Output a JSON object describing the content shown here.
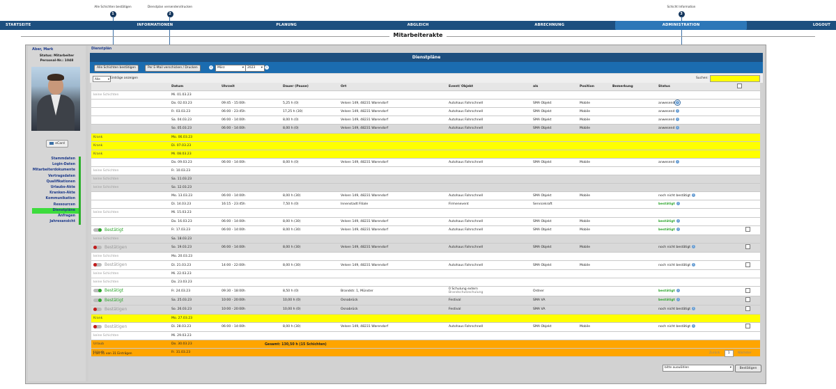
{
  "annotations": [
    {
      "label": "Alle Schichten bestätigen",
      "num": "1"
    },
    {
      "label": "Dienstplan versenden/drucken",
      "num": "2"
    },
    {
      "label": "Schicht Information",
      "num": "3"
    }
  ],
  "nav": [
    "STARTSEITE",
    "INFORMATIONEN",
    "PLANUNG",
    "ABGLEICH",
    "ABRECHNUNG",
    "ADMINISTRATION",
    "LOGOUT"
  ],
  "page_title": "Mitarbeiterakte",
  "employee": {
    "name": "Aber, Mark",
    "status": "Status: Mitarbeiter",
    "personal_nr": "Personal-Nr.: 1048",
    "ecard": "eCard"
  },
  "left_menu": [
    "Stammdaten",
    "Login-Daten",
    "Mitarbeiterdokumente",
    "Vertragsdaten",
    "Qualifikationen",
    "Urlaubs-Akte",
    "Kranken-Akte",
    "Kommunikation",
    "Ressourcen",
    "Dienstpläne",
    "Anfragen",
    "Jahresansicht"
  ],
  "breadcrumb": "Dienstplän",
  "panel_title": "Dienstpläne",
  "toolbar": {
    "confirm_all": "Alle Schichten bestätigen",
    "email_print": "Per E-Mail verschicken / Drucken",
    "month": "März",
    "year": "2023"
  },
  "list": {
    "length_select": "Alle",
    "length_text": "Einträge anzeigen",
    "search_label": "Suchen:"
  },
  "table": {
    "headers": [
      "",
      "Datum",
      "Uhrzeit",
      "Dauer (Pause)",
      "Ort",
      "Event/ Objekt",
      "als",
      "Position",
      "Bemerkung",
      "Status",
      ""
    ],
    "rows": [
      {
        "c": "n",
        "a": "keine Schichten",
        "d": "Mi. 01.03.23",
        "t": "",
        "dur": "",
        "o": "",
        "e": "",
        "e2": "",
        "al": "",
        "p": "",
        "b": "",
        "s": "",
        "si": false,
        "cb": false
      },
      {
        "c": "w",
        "a": "",
        "d": "Do. 02.03.23",
        "t": "09:45 - 15:00h",
        "dur": "5,25 h (0)",
        "o": "Velsen 149, 48231 Warendorf",
        "e": "Autohaus Fahrschnell",
        "e2": "",
        "al": "SMA Objekt",
        "p": "Mobile",
        "b": "",
        "s": "anwesend",
        "si": true,
        "ring": true,
        "cb": false
      },
      {
        "c": "w",
        "a": "",
        "d": "Fr. 03.03.23",
        "t": "06:00 - 23:45h",
        "dur": "17,25 h (30)",
        "o": "Velsen 149, 48231 Warendorf",
        "e": "Autohaus Fahrschnell",
        "e2": "",
        "al": "SMA Objekt",
        "p": "Mobile",
        "b": "",
        "s": "anwesend",
        "si": true,
        "cb": false
      },
      {
        "c": "w",
        "a": "",
        "d": "Sa. 04.03.23",
        "t": "06:00 - 14:00h",
        "dur": "8,00 h (0)",
        "o": "Velsen 149, 48231 Warendorf",
        "e": "Autohaus Fahrschnell",
        "e2": "",
        "al": "SMA Objekt",
        "p": "Mobile",
        "b": "",
        "s": "anwesend",
        "si": true,
        "cb": false
      },
      {
        "c": "g",
        "a": "",
        "d": "So. 05.03.23",
        "t": "06:00 - 14:00h",
        "dur": "8,00 h (0)",
        "o": "Velsen 149, 48231 Warendorf",
        "e": "Autohaus Fahrschnell",
        "e2": "",
        "al": "SMA Objekt",
        "p": "Mobile",
        "b": "",
        "s": "anwesend",
        "si": true,
        "cb": false
      },
      {
        "c": "k",
        "a": "Krank",
        "d": "Mo. 06.03.23",
        "t": "",
        "dur": "",
        "o": "",
        "e": "",
        "e2": "",
        "al": "",
        "p": "",
        "b": "",
        "s": "",
        "si": false,
        "cb": false
      },
      {
        "c": "k",
        "a": "Krank",
        "d": "Di. 07.03.23",
        "t": "",
        "dur": "",
        "o": "",
        "e": "",
        "e2": "",
        "al": "",
        "p": "",
        "b": "",
        "s": "",
        "si": false,
        "cb": false
      },
      {
        "c": "k",
        "a": "Krank",
        "d": "Mi. 08.03.23",
        "t": "",
        "dur": "",
        "o": "",
        "e": "",
        "e2": "",
        "al": "",
        "p": "",
        "b": "",
        "s": "",
        "si": false,
        "cb": false
      },
      {
        "c": "w",
        "a": "",
        "d": "Do. 09.03.23",
        "t": "06:00 - 14:00h",
        "dur": "8,00 h (0)",
        "o": "Velsen 149, 48231 Warendorf",
        "e": "Autohaus Fahrschnell",
        "e2": "",
        "al": "SMA Objekt",
        "p": "Mobile",
        "b": "",
        "s": "anwesend",
        "si": true,
        "cb": false
      },
      {
        "c": "n",
        "a": "keine Schichten",
        "d": "Fr. 10.03.23",
        "t": "",
        "dur": "",
        "o": "",
        "e": "",
        "e2": "",
        "al": "",
        "p": "",
        "b": "",
        "s": "",
        "si": false,
        "cb": false
      },
      {
        "c": "gn",
        "a": "keine Schichten",
        "d": "Sa. 11.03.23",
        "t": "",
        "dur": "",
        "o": "",
        "e": "",
        "e2": "",
        "al": "",
        "p": "",
        "b": "",
        "s": "",
        "si": false,
        "cb": false
      },
      {
        "c": "gn",
        "a": "keine Schichten",
        "d": "So. 12.03.23",
        "t": "",
        "dur": "",
        "o": "",
        "e": "",
        "e2": "",
        "al": "",
        "p": "",
        "b": "",
        "s": "",
        "si": false,
        "cb": false
      },
      {
        "c": "w",
        "a": "",
        "d": "Mo. 13.03.23",
        "t": "06:00 - 14:00h",
        "dur": "8,00 h (30)",
        "o": "Velsen 149, 48231 Warendorf",
        "e": "Autohaus Fahrschnell",
        "e2": "",
        "al": "SMA Objekt",
        "p": "Mobile",
        "b": "",
        "s": "noch nicht bestätigt",
        "si": true,
        "cb": false
      },
      {
        "c": "w",
        "a": "",
        "d": "Di. 14.03.23",
        "t": "16:15 - 23:45h",
        "dur": "7,50 h (0)",
        "o": "Innenstadt Filiale",
        "e": "Firmenevent",
        "e2": "",
        "al": "Servicekraft",
        "p": "",
        "b": "",
        "s": "bestätigt",
        "sg": true,
        "si": true,
        "cb": false
      },
      {
        "c": "n",
        "a": "keine Schichten",
        "d": "Mi. 15.03.23",
        "t": "",
        "dur": "",
        "o": "",
        "e": "",
        "e2": "",
        "al": "",
        "p": "",
        "b": "",
        "s": "",
        "si": false,
        "cb": false
      },
      {
        "c": "w",
        "a": "",
        "d": "Do. 16.03.23",
        "t": "06:00 - 14:00h",
        "dur": "8,00 h (30)",
        "o": "Velsen 149, 48231 Warendorf",
        "e": "Autohaus Fahrschnell",
        "e2": "",
        "al": "SMA Objekt",
        "p": "Mobile",
        "b": "",
        "s": "bestätigt",
        "sg": true,
        "si": true,
        "cb": false
      },
      {
        "c": "w",
        "a": "tog_on",
        "d": "Fr. 17.03.23",
        "t": "06:00 - 14:00h",
        "dur": "8,00 h (30)",
        "o": "Velsen 149, 48231 Warendorf",
        "e": "Autohaus Fahrschnell",
        "e2": "",
        "al": "SMA Objekt",
        "p": "Mobile",
        "b": "",
        "s": "bestätigt",
        "sg": true,
        "si": true,
        "cb": true
      },
      {
        "c": "gn",
        "a": "keine Schichten",
        "d": "Sa. 18.03.23",
        "t": "",
        "dur": "",
        "o": "",
        "e": "",
        "e2": "",
        "al": "",
        "p": "",
        "b": "",
        "s": "",
        "si": false,
        "cb": false
      },
      {
        "c": "g",
        "a": "tog_off",
        "d": "So. 19.03.23",
        "t": "06:00 - 14:00h",
        "dur": "8,00 h (30)",
        "o": "Velsen 149, 48231 Warendorf",
        "e": "Autohaus Fahrschnell",
        "e2": "",
        "al": "SMA Objekt",
        "p": "Mobile",
        "b": "",
        "s": "noch nicht bestätigt",
        "si": true,
        "cb": true
      },
      {
        "c": "n",
        "a": "keine Schichten",
        "d": "Mo. 20.03.23",
        "t": "",
        "dur": "",
        "o": "",
        "e": "",
        "e2": "",
        "al": "",
        "p": "",
        "b": "",
        "s": "",
        "si": false,
        "cb": false
      },
      {
        "c": "w",
        "a": "tog_off",
        "d": "Di. 21.03.23",
        "t": "14:00 - 22:00h",
        "dur": "8,00 h (30)",
        "o": "Velsen 149, 48231 Warendorf",
        "e": "Autohaus Fahrschnell",
        "e2": "",
        "al": "SMA Objekt",
        "p": "Mobile",
        "b": "",
        "s": "noch nicht bestätigt",
        "si": true,
        "cb": true
      },
      {
        "c": "n",
        "a": "keine Schichten",
        "d": "Mi. 22.03.23",
        "t": "",
        "dur": "",
        "o": "",
        "e": "",
        "e2": "",
        "al": "",
        "p": "",
        "b": "",
        "s": "",
        "si": false,
        "cb": false
      },
      {
        "c": "n",
        "a": "keine Schichten",
        "d": "Do. 23.03.23",
        "t": "",
        "dur": "",
        "o": "",
        "e": "",
        "e2": "",
        "al": "",
        "p": "",
        "b": "",
        "s": "",
        "si": false,
        "cb": false
      },
      {
        "c": "w",
        "a": "tog_on",
        "d": "Fr. 24.03.23",
        "t": "09:30 - 18:00h",
        "dur": "8,50 h (0)",
        "o": "Brandstr. 1, Münster",
        "e": "0 Schulung extern",
        "e2": "Brandschutzschulung",
        "al": "Ordner",
        "p": "",
        "b": "",
        "s": "bestätigt",
        "sg": true,
        "si": true,
        "cb": true
      },
      {
        "c": "g",
        "a": "tog_on",
        "d": "Sa. 25.03.23",
        "t": "10:00 - 20:00h",
        "dur": "10,00 h (0)",
        "o": "Osnabrück",
        "e": "Festival",
        "e2": "",
        "al": "SMA VA",
        "p": "",
        "b": "",
        "s": "bestätigt",
        "sg": true,
        "si": true,
        "cb": true
      },
      {
        "c": "g",
        "a": "tog_off",
        "d": "So. 26.03.23",
        "t": "10:00 - 20:00h",
        "dur": "10,00 h (0)",
        "o": "Osnabrück",
        "e": "Festival",
        "e2": "",
        "al": "SMA VA",
        "p": "",
        "b": "",
        "s": "noch nicht bestätigt",
        "si": true,
        "cb": true
      },
      {
        "c": "k",
        "a": "Krank",
        "d": "Mo. 27.03.23",
        "t": "",
        "dur": "",
        "o": "",
        "e": "",
        "e2": "",
        "al": "",
        "p": "",
        "b": "",
        "s": "",
        "si": false,
        "cb": false
      },
      {
        "c": "w",
        "a": "tog_off",
        "d": "Di. 28.03.23",
        "t": "06:00 - 14:00h",
        "dur": "8,00 h (30)",
        "o": "Velsen 149, 48231 Warendorf",
        "e": "Autohaus Fahrschnell",
        "e2": "",
        "al": "SMA Objekt",
        "p": "Mobile",
        "b": "",
        "s": "noch nicht bestätigt",
        "si": true,
        "cb": true
      },
      {
        "c": "n",
        "a": "keine Schichten",
        "d": "Mi. 29.03.23",
        "t": "",
        "dur": "",
        "o": "",
        "e": "",
        "e2": "",
        "al": "",
        "p": "",
        "b": "",
        "s": "",
        "si": false,
        "cb": false
      },
      {
        "c": "u",
        "a": "Urlaub",
        "d": "Do. 30.03.23",
        "t": "",
        "dur": "",
        "o": "",
        "e": "",
        "e2": "",
        "al": "",
        "p": "",
        "b": "",
        "s": "",
        "si": false,
        "cb": false
      },
      {
        "c": "u",
        "a": "Urlaub",
        "d": "Fr. 31.03.23",
        "t": "",
        "dur": "",
        "o": "",
        "e": "",
        "e2": "",
        "al": "",
        "p": "",
        "b": "",
        "s": "",
        "si": false,
        "cb": false
      }
    ]
  },
  "toggle_labels": {
    "on": "Bestätigt",
    "off": "Bestätigen"
  },
  "total": "Gesamt:   130,50 h (15 Schichten)",
  "pager": {
    "info": "1 bis 31 von 31 Einträgen",
    "prev": "Zurück",
    "page": "1",
    "next": "Nächster"
  },
  "bottom": {
    "select": "bitte auswählen",
    "button": "Bestätigen"
  }
}
